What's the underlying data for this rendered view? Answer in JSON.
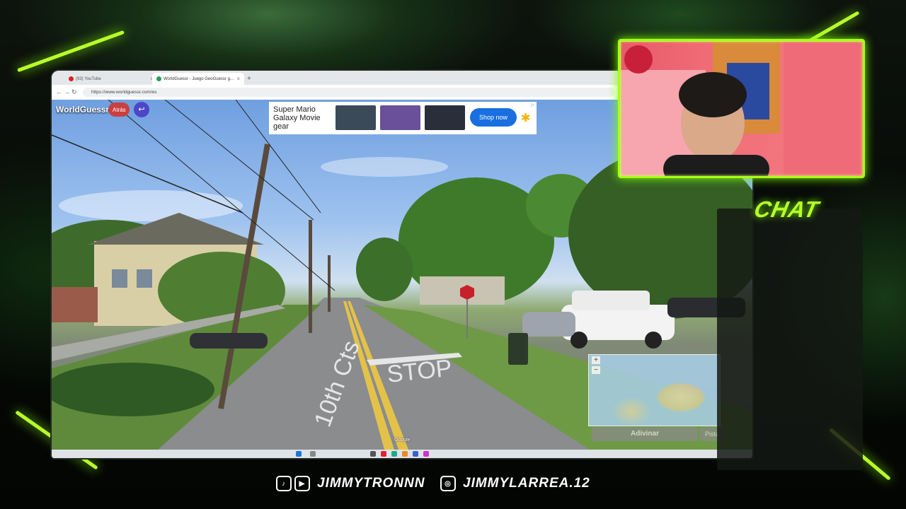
{
  "browser": {
    "tabs": [
      {
        "label": "(93) YouTube",
        "color": "#e02020"
      },
      {
        "label": "WorldGuessr - Juego GeoGuessr g...",
        "color": "#2a9d5b"
      }
    ],
    "new_tab": "+",
    "url": "https://www.worldguessr.com/es"
  },
  "game": {
    "brand": "WorldGuessr",
    "back_label": "Atrás",
    "return_icon": "↩",
    "guess_label": "Adivinar",
    "hint_label": "Pista",
    "map_zoom_in": "+",
    "map_zoom_out": "−",
    "google_label": "Google",
    "road_text": [
      "10th Cts",
      "STOP"
    ],
    "stop_sign": "STOP"
  },
  "ad": {
    "headline": "Super Mario Galaxy Movie gear",
    "cta": "Shop now",
    "logo_icon": "walmart-spark-icon",
    "ad_choices": "▷"
  },
  "overlay": {
    "chat_title": "CHAT",
    "tiktok_youtube_handle": "JIMMYTRONNN",
    "instagram_handle": "JIMMYLARREA.12"
  },
  "colors": {
    "neon": "#a8ff14",
    "back_button": "#c94040",
    "return_button": "#4b47c8",
    "shop_button": "#1a6fe0"
  }
}
